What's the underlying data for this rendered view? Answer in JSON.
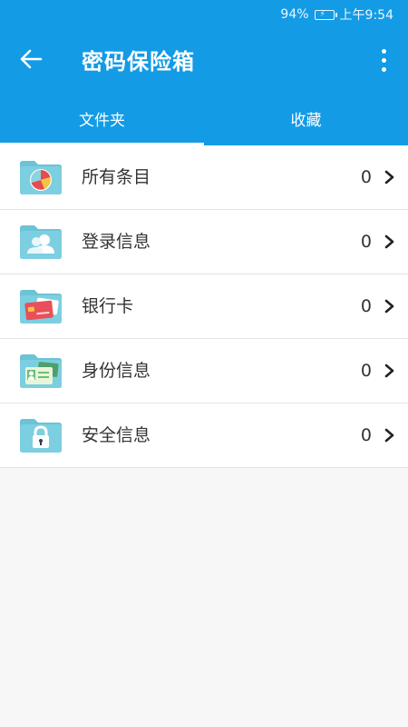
{
  "status_bar": {
    "battery": "94%",
    "time": "上午9:54"
  },
  "header": {
    "title": "密码保险箱"
  },
  "tabs": [
    {
      "label": "文件夹",
      "active": true
    },
    {
      "label": "收藏",
      "active": false
    }
  ],
  "folders": [
    {
      "label": "所有条目",
      "count": "0",
      "icon": "pie-chart-folder-icon"
    },
    {
      "label": "登录信息",
      "count": "0",
      "icon": "users-folder-icon"
    },
    {
      "label": "银行卡",
      "count": "0",
      "icon": "bank-card-folder-icon"
    },
    {
      "label": "身份信息",
      "count": "0",
      "icon": "id-card-folder-icon"
    },
    {
      "label": "安全信息",
      "count": "0",
      "icon": "lock-folder-icon"
    }
  ],
  "colors": {
    "header": "#139be6",
    "folder": "#6cc3d5"
  }
}
